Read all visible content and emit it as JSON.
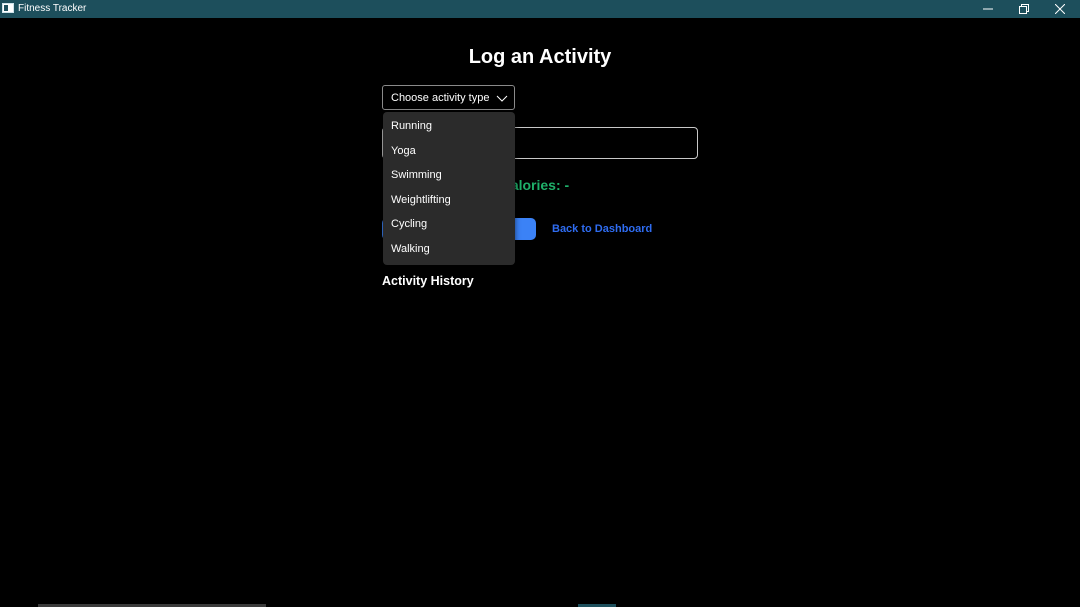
{
  "window": {
    "title": "Fitness Tracker",
    "controls": {
      "minimize_icon": "minimize-icon",
      "maximize_icon": "restore-icon",
      "close_icon": "close-icon"
    }
  },
  "page": {
    "title": "Log an Activity"
  },
  "form": {
    "activity_select": {
      "placeholder": "Choose activity type",
      "icon": "chevron-down-icon",
      "options": [
        "Running",
        "Yoga",
        "Swimming",
        "Weightlifting",
        "Cycling",
        "Walking"
      ]
    },
    "duration_input": {
      "value": ""
    },
    "calories_label": "alories: -",
    "save_button_label": "",
    "back_link_label": "Back to Dashboard"
  },
  "history": {
    "heading": "Activity History"
  },
  "colors": {
    "titlebar": "#1d4f5c",
    "background": "#000000",
    "calories_green": "#1fb06a",
    "button_blue": "#3b82f6",
    "link_blue": "#2f6cf0",
    "dropdown_bg": "#2b2b2b"
  }
}
